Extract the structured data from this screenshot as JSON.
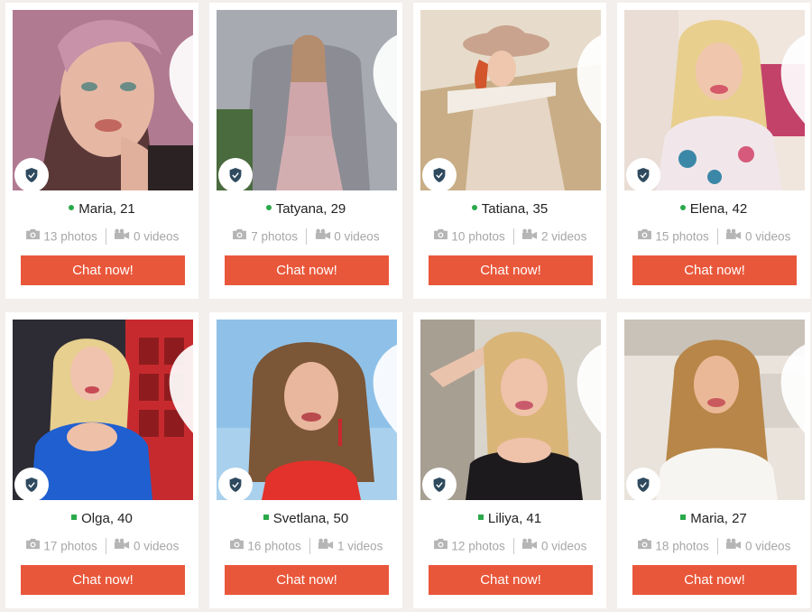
{
  "colors": {
    "accent": "#e9573a",
    "online": "#2aa94a",
    "muted_text": "#a7a7a7",
    "background": "#f3efec"
  },
  "profiles": [
    {
      "name": "Maria, 21",
      "photos": "13 photos",
      "videos": "0 videos",
      "cta": "Chat now!",
      "online_marker": "round"
    },
    {
      "name": "Tatyana, 29",
      "photos": "7 photos",
      "videos": "0 videos",
      "cta": "Chat now!",
      "online_marker": "round"
    },
    {
      "name": "Tatiana, 35",
      "photos": "10 photos",
      "videos": "2 videos",
      "cta": "Chat now!",
      "online_marker": "round"
    },
    {
      "name": "Elena, 42",
      "photos": "15 photos",
      "videos": "0 videos",
      "cta": "Chat now!",
      "online_marker": "round"
    },
    {
      "name": "Olga, 40",
      "photos": "17 photos",
      "videos": "0 videos",
      "cta": "Chat now!",
      "online_marker": "square"
    },
    {
      "name": "Svetlana, 50",
      "photos": "16 photos",
      "videos": "1 videos",
      "cta": "Chat now!",
      "online_marker": "square"
    },
    {
      "name": "Liliya, 41",
      "photos": "12 photos",
      "videos": "0 videos",
      "cta": "Chat now!",
      "online_marker": "square"
    },
    {
      "name": "Maria, 27",
      "photos": "18 photos",
      "videos": "0 videos",
      "cta": "Chat now!",
      "online_marker": "square"
    }
  ],
  "icons": {
    "favorite": "heart-icon",
    "verified": "shield-check-icon",
    "photos": "camera-icon",
    "videos": "video-camera-icon",
    "online": "online-dot-icon"
  }
}
